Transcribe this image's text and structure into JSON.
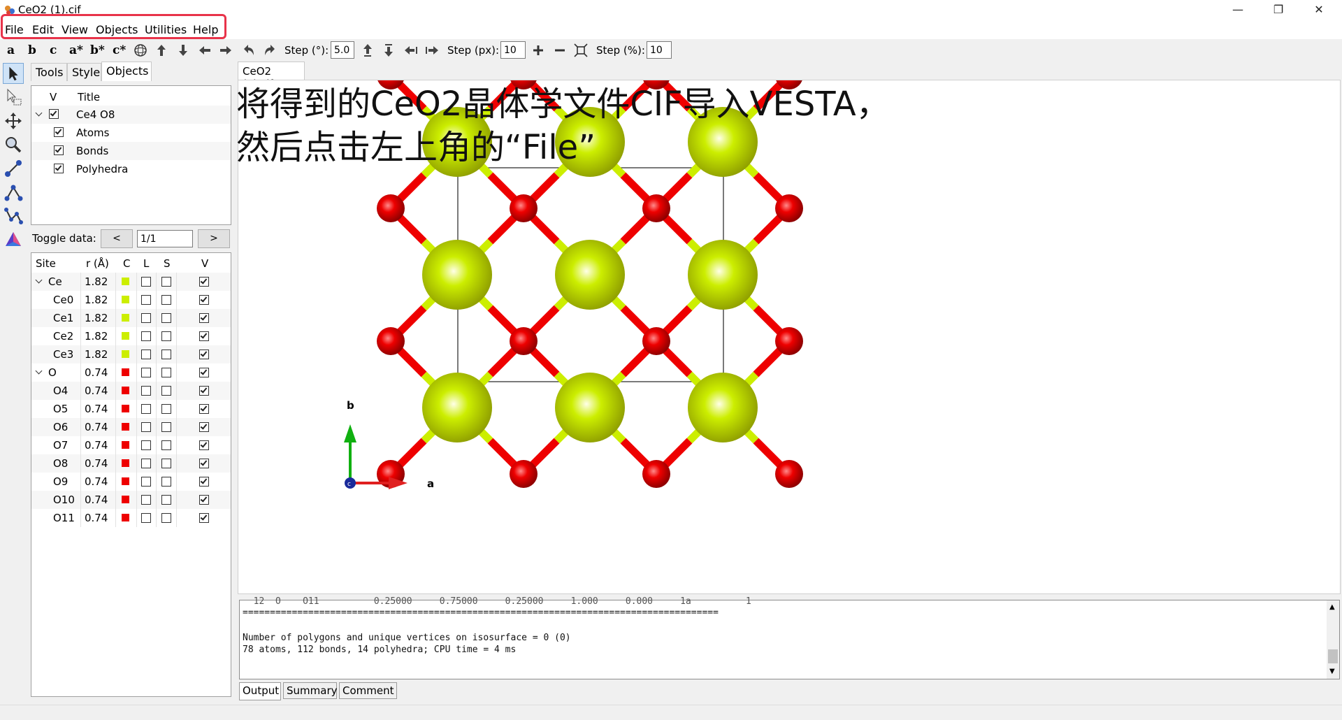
{
  "window": {
    "title": "CeO2 (1).cif",
    "controls": [
      "minimize-icon",
      "restore-icon",
      "close-icon"
    ]
  },
  "menu": [
    "File",
    "Edit",
    "View",
    "Objects",
    "Utilities",
    "Help"
  ],
  "toolbar": {
    "axis_buttons": [
      "a",
      "b",
      "c",
      "a*",
      "b*",
      "c*"
    ],
    "step_deg_label": "Step (°):",
    "step_deg_value": "5.0",
    "step_px_label": "Step (px):",
    "step_px_value": "10",
    "step_pct_label": "Step (%):",
    "step_pct_value": "10"
  },
  "side_tabs": [
    "Tools",
    "Style",
    "Objects"
  ],
  "tree": {
    "header_v": "V",
    "header_title": "Title",
    "items": [
      {
        "label": "Ce4 O8",
        "checked": true,
        "level": 0
      },
      {
        "label": "Atoms",
        "checked": true,
        "level": 1
      },
      {
        "label": "Bonds",
        "checked": true,
        "level": 1
      },
      {
        "label": "Polyhedra",
        "checked": true,
        "level": 1
      }
    ]
  },
  "toggle": {
    "label": "Toggle data:",
    "prev": "<",
    "value": "1/1",
    "next": ">"
  },
  "sites": {
    "headers": [
      "Site",
      "r (Å)",
      "C",
      "L",
      "S",
      "V"
    ],
    "rows": [
      {
        "site": "Ce",
        "r": "1.82",
        "color": "#ccee00",
        "group": true
      },
      {
        "site": "Ce0",
        "r": "1.82",
        "color": "#ccee00"
      },
      {
        "site": "Ce1",
        "r": "1.82",
        "color": "#ccee00"
      },
      {
        "site": "Ce2",
        "r": "1.82",
        "color": "#ccee00"
      },
      {
        "site": "Ce3",
        "r": "1.82",
        "color": "#ccee00"
      },
      {
        "site": "O",
        "r": "0.74",
        "color": "#ee0000",
        "group": true
      },
      {
        "site": "O4",
        "r": "0.74",
        "color": "#ee0000"
      },
      {
        "site": "O5",
        "r": "0.74",
        "color": "#ee0000"
      },
      {
        "site": "O6",
        "r": "0.74",
        "color": "#ee0000"
      },
      {
        "site": "O7",
        "r": "0.74",
        "color": "#ee0000"
      },
      {
        "site": "O8",
        "r": "0.74",
        "color": "#ee0000"
      },
      {
        "site": "O9",
        "r": "0.74",
        "color": "#ee0000"
      },
      {
        "site": "O10",
        "r": "0.74",
        "color": "#ee0000"
      },
      {
        "site": "O11",
        "r": "0.74",
        "color": "#ee0000"
      }
    ]
  },
  "document_tab": "CeO2 (1).cif",
  "overlay": {
    "line1": "将得到的CeO2晶体学文件CIF导入VESTA，",
    "line2": "然后点击左上角的“File”"
  },
  "axes": {
    "a": "a",
    "b": "b",
    "c": "c"
  },
  "colors": {
    "ce": "#ccee00",
    "o": "#ee0000",
    "highlight": "#e8334a"
  },
  "output": {
    "lines": [
      "  12  O    O11          0.25000     0.75000     0.25000     1.000     0.000     1a          1",
      "=======================================================================================",
      "",
      "Number of polygons and unique vertices on isosurface = 0 (0)",
      "78 atoms, 112 bonds, 14 polyhedra; CPU time = 4 ms"
    ],
    "tabs": [
      "Output",
      "Summary",
      "Comment"
    ]
  }
}
